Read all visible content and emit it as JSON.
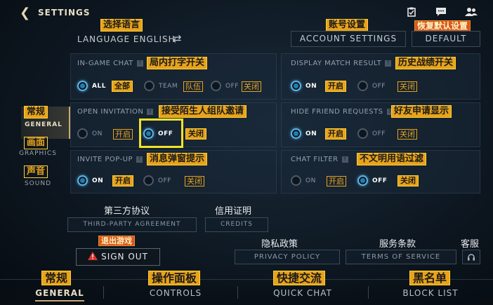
{
  "header": {
    "back_icon": "chevron-left-icon",
    "title": "SETTINGS",
    "icons": [
      "clipboard-icon",
      "chat-icon",
      "friends-icon"
    ]
  },
  "language": {
    "annotation": "选择语言",
    "label": "LANGUAGE ENGLISH",
    "swap_icon": "⇄"
  },
  "account": {
    "annotation": "账号设置",
    "label": "ACCOUNT SETTINGS"
  },
  "default": {
    "annotation": "恢复默认设置",
    "label": "DEFAULT"
  },
  "panels": {
    "in_game_chat": {
      "title": "IN-GAME CHAT",
      "annotation": "局内打字开关",
      "options": [
        {
          "label": "ALL",
          "annotation": "全部",
          "selected": true
        },
        {
          "label": "TEAM",
          "annotation": "队伍",
          "selected": false
        },
        {
          "label": "OFF",
          "annotation": "关闭",
          "selected": false
        }
      ]
    },
    "display_match_result": {
      "title": "DISPLAY MATCH RESULT",
      "annotation": "历史战绩开关",
      "options": [
        {
          "label": "ON",
          "annotation": "开启",
          "selected": true
        },
        {
          "label": "OFF",
          "annotation": "关闭",
          "selected": false
        }
      ]
    },
    "open_invitation": {
      "title": "OPEN INVITATION",
      "annotation": "接受陌生人组队邀请",
      "options": [
        {
          "label": "ON",
          "annotation": "开启",
          "selected": false
        },
        {
          "label": "OFF",
          "annotation": "关闭",
          "selected": true
        }
      ]
    },
    "hide_friend_requests": {
      "title": "HIDE FRIEND REQUESTS",
      "annotation": "好友申请显示",
      "options": [
        {
          "label": "ON",
          "annotation": "开启",
          "selected": true
        },
        {
          "label": "OFF",
          "annotation": "关闭",
          "selected": false
        }
      ]
    },
    "invite_popup": {
      "title": "INVITE POP-UP",
      "annotation": "消息弹窗提示",
      "options": [
        {
          "label": "ON",
          "annotation": "开启",
          "selected": true
        },
        {
          "label": "OFF",
          "annotation": "关闭",
          "selected": false
        }
      ]
    },
    "chat_filter": {
      "title": "CHAT FILTER",
      "annotation": "不文明用语过滤",
      "options": [
        {
          "label": "ON",
          "annotation": "开启",
          "selected": false
        },
        {
          "label": "OFF",
          "annotation": "关闭",
          "selected": true
        }
      ]
    }
  },
  "left_nav": [
    {
      "annotation": "常规",
      "label": "GENERAL",
      "selected": true
    },
    {
      "annotation": "画面",
      "label": "GRAPHICS",
      "selected": false
    },
    {
      "annotation": "声音",
      "label": "SOUND",
      "selected": false
    }
  ],
  "links": {
    "third_party": {
      "cn": "第三方协议",
      "label": "THIRD-PARTY AGREEMENT"
    },
    "credits": {
      "cn": "信用证明",
      "label": "CREDITS"
    },
    "privacy": {
      "cn": "隐私政策",
      "label": "PRIVACY POLICY"
    },
    "terms": {
      "cn": "服务条款",
      "label": "TERMS OF SERVICE"
    },
    "support": {
      "cn": "客服",
      "icon": "headset-icon"
    }
  },
  "sign_out": {
    "annotation": "退出游戏",
    "label": "SIGN OUT",
    "icon": "warning-icon"
  },
  "bottom_tabs": [
    {
      "annotation": "常规",
      "label": "GENERAL",
      "selected": true
    },
    {
      "annotation": "操作面板",
      "label": "CONTROLS",
      "selected": false
    },
    {
      "annotation": "快捷交流",
      "label": "QUICK CHAT",
      "selected": false
    },
    {
      "annotation": "黑名单",
      "label": "BLOCK LIST",
      "selected": false
    }
  ],
  "colors": {
    "accent_gold": "#c8aa6e",
    "radio_selected": "#62b6e0",
    "annotation_bg": "#e8a31a",
    "annotation_red": "#d8581c",
    "highlight_box": "#f2e22a"
  }
}
